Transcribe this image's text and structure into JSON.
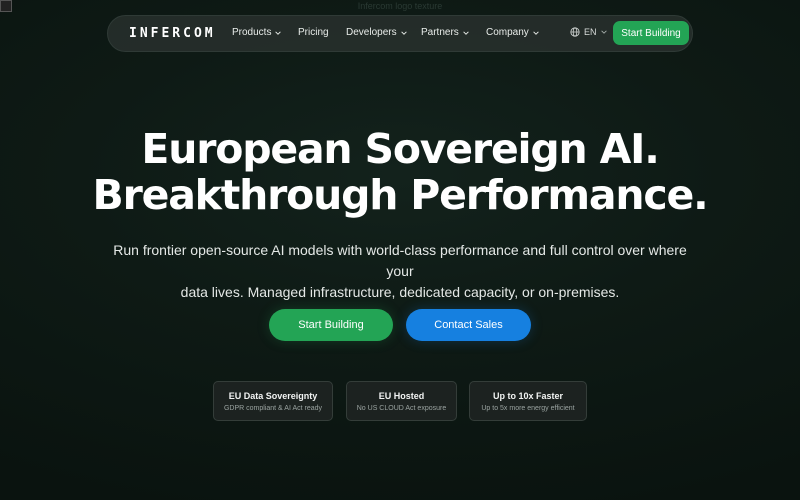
{
  "page": {
    "image_alt": "Infercom logo texture"
  },
  "nav": {
    "logo": "INFERCOM",
    "items": [
      {
        "label": "Products",
        "has_dropdown": true
      },
      {
        "label": "Pricing",
        "has_dropdown": false
      },
      {
        "label": "Developers",
        "has_dropdown": true
      },
      {
        "label": "Partners",
        "has_dropdown": true
      },
      {
        "label": "Company",
        "has_dropdown": true
      }
    ],
    "language": "EN",
    "language_icon": "globe-icon",
    "cta": "Start Building"
  },
  "hero": {
    "title_line1": "European Sovereign AI.",
    "title_line2": "Breakthrough Performance.",
    "subtitle_line1": "Run frontier open-source AI models with world-class performance and full control over where your",
    "subtitle_line2": "data lives. Managed infrastructure, dedicated capacity, or on-premises.",
    "primary_button": "Start Building",
    "secondary_button": "Contact Sales"
  },
  "features": [
    {
      "title": "EU Data Sovereignty",
      "desc": "GDPR compliant & AI Act ready"
    },
    {
      "title": "EU Hosted",
      "desc": "No US CLOUD Act exposure"
    },
    {
      "title": "Up to 10x Faster",
      "desc": "Up to 5x more energy efficient"
    }
  ],
  "colors": {
    "background": "#0e1a15",
    "primary_green": "#23a455",
    "secondary_blue": "#1680e0",
    "nav_background": "#28302d"
  }
}
